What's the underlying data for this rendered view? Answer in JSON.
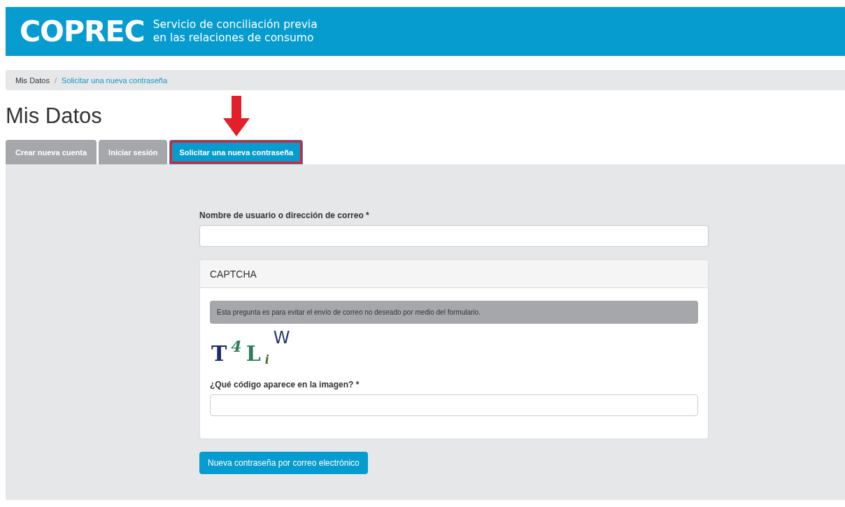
{
  "header": {
    "logo": "COPREC",
    "tagline_lines": [
      "Servicio de conciliación previa",
      "en las relaciones de consumo"
    ]
  },
  "breadcrumb_separator": "/",
  "breadcrumb": [
    {
      "label": "Mis Datos",
      "kind": "text"
    },
    {
      "label": "Solicitar una nueva contraseña",
      "kind": "link"
    }
  ],
  "page_title": "Mis Datos",
  "tabs": [
    {
      "label": "Crear nueva cuenta",
      "selected": false,
      "highlighted": false
    },
    {
      "label": "Iniciar sesión",
      "selected": false,
      "highlighted": false
    },
    {
      "label": "Solicitar una nueva contraseña",
      "selected": true,
      "highlighted": true
    }
  ],
  "form": {
    "username_label": "Nombre de usuario o dirección de correo *",
    "captcha": {
      "title": "CAPTCHA",
      "notice": "Esta pregunta es para evitar el envío de correo no deseado por medio del formulario.",
      "characters": [
        {
          "char": "T",
          "color": "#1c2a6b"
        },
        {
          "char": "4",
          "color": "#2e7d5b"
        },
        {
          "char": "L",
          "color": "#2e7d5b"
        },
        {
          "char": "i",
          "color": "#3d6b1f"
        },
        {
          "char": "W",
          "color": "#253a6a"
        }
      ],
      "answer_label": "¿Qué código aparece en la imagen? *"
    },
    "submit": "Nueva contraseña por correo electrónico"
  }
}
